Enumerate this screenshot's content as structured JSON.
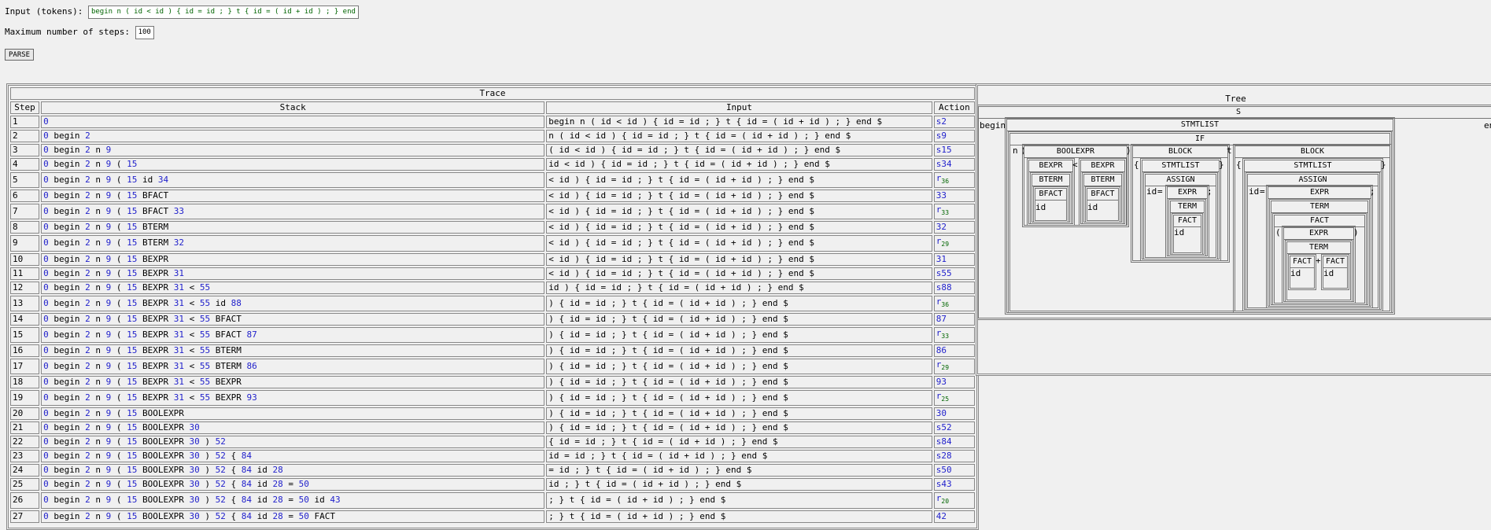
{
  "form": {
    "input_label": "Input (tokens):",
    "input_value": "begin n ( id < id ) { id = id ; } t { id = ( id + id ) ; } end",
    "steps_label": "Maximum number of steps:",
    "steps_value": "100",
    "parse_label": "PARSE"
  },
  "trace": {
    "title": "Trace",
    "headers": {
      "step": "Step",
      "stack": "Stack",
      "input": "Input",
      "action": "Action"
    },
    "rows": [
      {
        "step": "1",
        "stack": "0",
        "input": "begin n ( id < id ) { id = id ; } t { id = ( id + id ) ; } end $",
        "action": "s2"
      },
      {
        "step": "2",
        "stack": "0 begin 2",
        "input": "n ( id < id ) { id = id ; } t { id = ( id + id ) ; } end $",
        "action": "s9"
      },
      {
        "step": "3",
        "stack": "0 begin 2 n 9",
        "input": "( id < id ) { id = id ; } t { id = ( id + id ) ; } end $",
        "action": "s15"
      },
      {
        "step": "4",
        "stack": "0 begin 2 n 9 ( 15",
        "input": "id < id ) { id = id ; } t { id = ( id + id ) ; } end $",
        "action": "s34"
      },
      {
        "step": "5",
        "stack": "0 begin 2 n 9 ( 15 id 34",
        "input": "< id ) { id = id ; } t { id = ( id + id ) ; } end $",
        "action": "r",
        "sub": "36"
      },
      {
        "step": "6",
        "stack": "0 begin 2 n 9 ( 15 BFACT",
        "input": "< id ) { id = id ; } t { id = ( id + id ) ; } end $",
        "action": "33"
      },
      {
        "step": "7",
        "stack": "0 begin 2 n 9 ( 15 BFACT 33",
        "input": "< id ) { id = id ; } t { id = ( id + id ) ; } end $",
        "action": "r",
        "sub": "33"
      },
      {
        "step": "8",
        "stack": "0 begin 2 n 9 ( 15 BTERM",
        "input": "< id ) { id = id ; } t { id = ( id + id ) ; } end $",
        "action": "32"
      },
      {
        "step": "9",
        "stack": "0 begin 2 n 9 ( 15 BTERM 32",
        "input": "< id ) { id = id ; } t { id = ( id + id ) ; } end $",
        "action": "r",
        "sub": "29"
      },
      {
        "step": "10",
        "stack": "0 begin 2 n 9 ( 15 BEXPR",
        "input": "< id ) { id = id ; } t { id = ( id + id ) ; } end $",
        "action": "31"
      },
      {
        "step": "11",
        "stack": "0 begin 2 n 9 ( 15 BEXPR 31",
        "input": "< id ) { id = id ; } t { id = ( id + id ) ; } end $",
        "action": "s55"
      },
      {
        "step": "12",
        "stack": "0 begin 2 n 9 ( 15 BEXPR 31 < 55",
        "input": "id ) { id = id ; } t { id = ( id + id ) ; } end $",
        "action": "s88"
      },
      {
        "step": "13",
        "stack": "0 begin 2 n 9 ( 15 BEXPR 31 < 55 id 88",
        "input": ") { id = id ; } t { id = ( id + id ) ; } end $",
        "action": "r",
        "sub": "36"
      },
      {
        "step": "14",
        "stack": "0 begin 2 n 9 ( 15 BEXPR 31 < 55 BFACT",
        "input": ") { id = id ; } t { id = ( id + id ) ; } end $",
        "action": "87"
      },
      {
        "step": "15",
        "stack": "0 begin 2 n 9 ( 15 BEXPR 31 < 55 BFACT 87",
        "input": ") { id = id ; } t { id = ( id + id ) ; } end $",
        "action": "r",
        "sub": "33"
      },
      {
        "step": "16",
        "stack": "0 begin 2 n 9 ( 15 BEXPR 31 < 55 BTERM",
        "input": ") { id = id ; } t { id = ( id + id ) ; } end $",
        "action": "86"
      },
      {
        "step": "17",
        "stack": "0 begin 2 n 9 ( 15 BEXPR 31 < 55 BTERM 86",
        "input": ") { id = id ; } t { id = ( id + id ) ; } end $",
        "action": "r",
        "sub": "29"
      },
      {
        "step": "18",
        "stack": "0 begin 2 n 9 ( 15 BEXPR 31 < 55 BEXPR",
        "input": ") { id = id ; } t { id = ( id + id ) ; } end $",
        "action": "93"
      },
      {
        "step": "19",
        "stack": "0 begin 2 n 9 ( 15 BEXPR 31 < 55 BEXPR 93",
        "input": ") { id = id ; } t { id = ( id + id ) ; } end $",
        "action": "r",
        "sub": "25"
      },
      {
        "step": "20",
        "stack": "0 begin 2 n 9 ( 15 BOOLEXPR",
        "input": ") { id = id ; } t { id = ( id + id ) ; } end $",
        "action": "30"
      },
      {
        "step": "21",
        "stack": "0 begin 2 n 9 ( 15 BOOLEXPR 30",
        "input": ") { id = id ; } t { id = ( id + id ) ; } end $",
        "action": "s52"
      },
      {
        "step": "22",
        "stack": "0 begin 2 n 9 ( 15 BOOLEXPR 30 ) 52",
        "input": "{ id = id ; } t { id = ( id + id ) ; } end $",
        "action": "s84"
      },
      {
        "step": "23",
        "stack": "0 begin 2 n 9 ( 15 BOOLEXPR 30 ) 52 { 84",
        "input": "id = id ; } t { id = ( id + id ) ; } end $",
        "action": "s28"
      },
      {
        "step": "24",
        "stack": "0 begin 2 n 9 ( 15 BOOLEXPR 30 ) 52 { 84 id 28",
        "input": "= id ; } t { id = ( id + id ) ; } end $",
        "action": "s50"
      },
      {
        "step": "25",
        "stack": "0 begin 2 n 9 ( 15 BOOLEXPR 30 ) 52 { 84 id 28 = 50",
        "input": "id ; } t { id = ( id + id ) ; } end $",
        "action": "s43"
      },
      {
        "step": "26",
        "stack": "0 begin 2 n 9 ( 15 BOOLEXPR 30 ) 52 { 84 id 28 = 50 id 43",
        "input": "; } t { id = ( id + id ) ; } end $",
        "action": "r",
        "sub": "20"
      },
      {
        "step": "27",
        "stack": "0 begin 2 n 9 ( 15 BOOLEXPR 30 ) 52 { 84 id 28 = 50 FACT",
        "input": "; } t { id = ( id + id ) ; } end $",
        "action": "42"
      }
    ]
  },
  "tree": {
    "title": "Tree",
    "root": "S",
    "begin": "begin",
    "end": "en",
    "stmtlist": "STMTLIST",
    "if": "IF",
    "n": "n",
    "lparen": "(",
    "rparen": ")",
    "t": "t",
    "boolexpr": "BOOLEXPR",
    "bexpr": "BEXPR",
    "bterm": "BTERM",
    "bfact": "BFACT",
    "lt": "<",
    "id": "id",
    "block": "BLOCK",
    "lbrace": "{",
    "rbrace": "}",
    "assign": "ASSIGN",
    "eq": "=",
    "semi": ";",
    "expr": "EXPR",
    "term": "TERM",
    "fact": "FACT",
    "plus": "+"
  }
}
